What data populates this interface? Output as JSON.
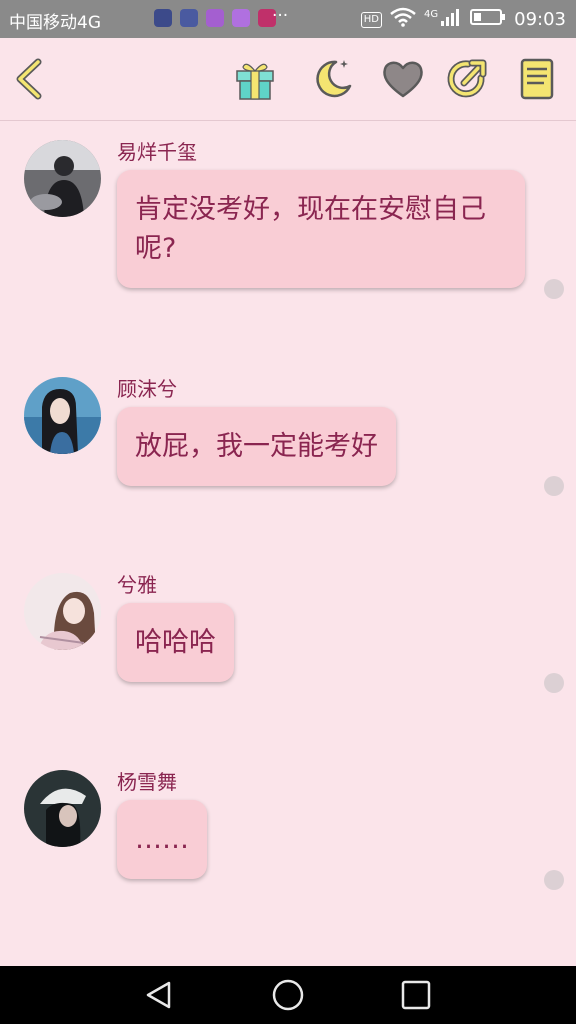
{
  "status_bar": {
    "carrier": "中国移动4G",
    "dots": "···",
    "hd": "HD",
    "network": "4G",
    "time": "09:03"
  },
  "toolbar": {
    "icons": [
      "back-arrow-icon",
      "gift-icon",
      "moon-icon",
      "heart-icon",
      "share-icon",
      "notebook-icon"
    ]
  },
  "colors": {
    "background": "#fbe4ea",
    "bubble": "#f9cdd5",
    "text": "#8a2550",
    "accent_yellow": "#f4e571",
    "icon_outline": "#5a5a5a"
  },
  "messages": [
    {
      "user": "易烊千玺",
      "text_line1": "肯定没考好，现在在安慰自己",
      "text_line2": "呢?"
    },
    {
      "user": "顾沫兮",
      "text_line1": "放屁，我一定能考好"
    },
    {
      "user": "兮雅",
      "text_line1": "哈哈哈"
    },
    {
      "user": "杨雪舞",
      "text_line1": "……"
    }
  ],
  "nav_bar": {
    "icons": [
      "back-triangle-icon",
      "home-circle-icon",
      "recents-square-icon"
    ]
  }
}
